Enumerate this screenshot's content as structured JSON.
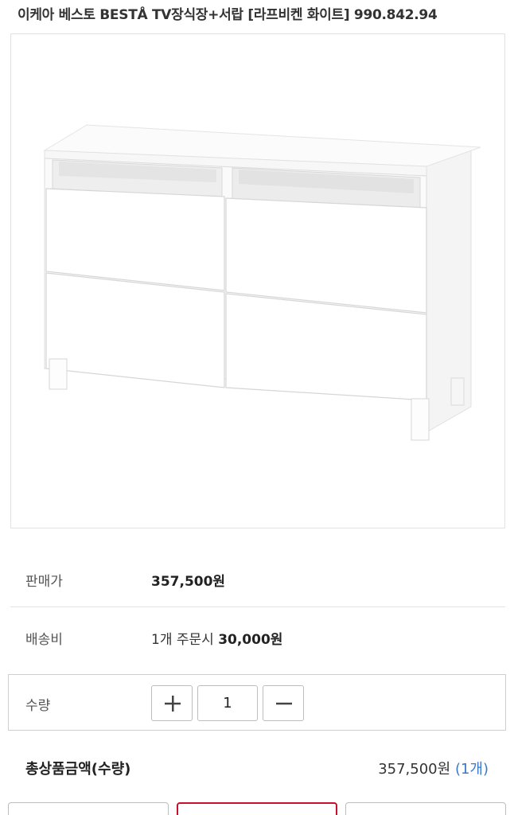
{
  "product": {
    "title": "이케아 베스토 BESTÅ TV장식장+서랍 [라프비켄 화이트] 990.842.94"
  },
  "price": {
    "label": "판매가",
    "value": "357,500원"
  },
  "shipping": {
    "label": "배송비",
    "prefix": "1개 주문시",
    "value": "30,000원"
  },
  "quantity": {
    "label": "수량",
    "value": "1",
    "increase_icon": "plus-icon",
    "decrease_icon": "minus-icon"
  },
  "total": {
    "label": "총상품금액(수량)",
    "value": "357,500원",
    "count": "(1개)"
  },
  "colors": {
    "accent_red": "#c8102e",
    "count_blue": "#3a79c9"
  }
}
